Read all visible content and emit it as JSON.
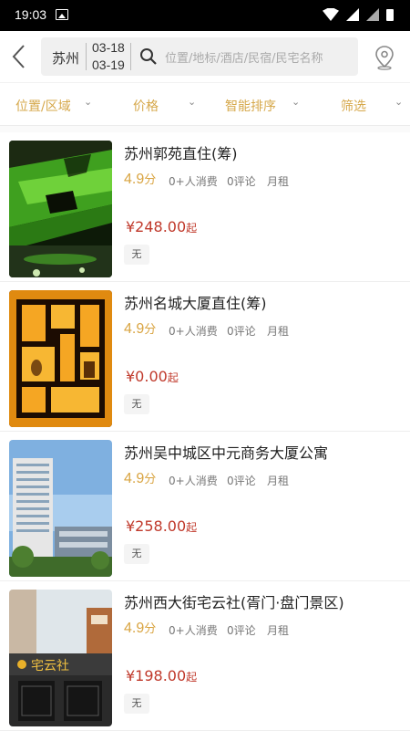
{
  "status_bar": {
    "time": "19:03"
  },
  "header": {
    "city": "苏州",
    "checkin": "03-18",
    "checkout": "03-19",
    "search_placeholder": "位置/地标/酒店/民宿/民宅名称"
  },
  "filters": [
    {
      "label": "位置/区域"
    },
    {
      "label": "价格"
    },
    {
      "label": "智能排序"
    },
    {
      "label": "筛选"
    }
  ],
  "listings": [
    {
      "title": "苏州郭苑直住(筹)",
      "score": "4.9",
      "score_unit": "分",
      "consumers": "0+人消费",
      "reviews": "0评论",
      "rent_type": "月租",
      "price": "¥248.00",
      "price_suffix": "起",
      "tag": "无"
    },
    {
      "title": "苏州名城大厦直住(筹)",
      "score": "4.9",
      "score_unit": "分",
      "consumers": "0+人消费",
      "reviews": "0评论",
      "rent_type": "月租",
      "price": "¥0.00",
      "price_suffix": "起",
      "tag": "无"
    },
    {
      "title": "苏州吴中城区中元商务大厦公寓",
      "score": "4.9",
      "score_unit": "分",
      "consumers": "0+人消费",
      "reviews": "0评论",
      "rent_type": "月租",
      "price": "¥258.00",
      "price_suffix": "起",
      "tag": "无"
    },
    {
      "title": "苏州西大街宅云社(胥门·盘门景区)",
      "score": "4.9",
      "score_unit": "分",
      "consumers": "0+人消费",
      "reviews": "0评论",
      "rent_type": "月租",
      "price": "¥198.00",
      "price_suffix": "起",
      "tag": "无",
      "sign_text": "宅云社"
    }
  ],
  "colors": {
    "accent": "#d6a84b",
    "price": "#c0392b"
  }
}
